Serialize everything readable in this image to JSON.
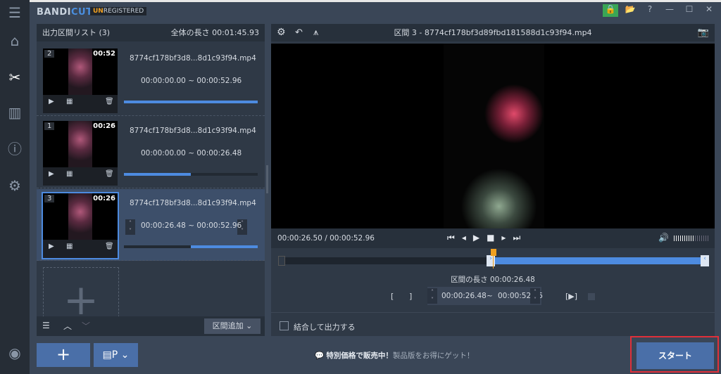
{
  "app": {
    "logo_a": "BANDI",
    "logo_b": "CUT",
    "unreg_a": "UN",
    "unreg_b": "REGISTERED"
  },
  "window": {
    "lock": "🔒",
    "folder": "📂",
    "help": "?",
    "min": "—",
    "max": "☐",
    "close": "✕"
  },
  "sidebar": [
    "menu-icon",
    "home-icon",
    "cut-icon",
    "film-icon",
    "info-icon",
    "gear-icon",
    "record-icon"
  ],
  "list": {
    "title": "出力区間リスト (3)",
    "total": "全体の長さ 00:01:45.93",
    "items": [
      {
        "num": "2",
        "dur": "00:52",
        "file": "8774cf178bf3d8...8d1c93f94.mp4",
        "range": "00:00:00.00 ~ 00:00:52.96",
        "progress": 100,
        "selected": false
      },
      {
        "num": "1",
        "dur": "00:26",
        "file": "8774cf178bf3d8...8d1c93f94.mp4",
        "range": "00:00:00.00 ~ 00:00:26.48",
        "progress": 50,
        "selected": false
      },
      {
        "num": "3",
        "dur": "00:26",
        "file": "8774cf178bf3d8...8d1c93f94.mp4",
        "range": "00:00:26.48 ~ 00:00:52.96",
        "progress": 50,
        "selected": true
      }
    ],
    "add_segment": "区間追加"
  },
  "player": {
    "title": "区間 3 - 8774cf178bf3d89fbd181588d1c93f94.mp4",
    "time": "00:00:26.50 / 00:00:52.96",
    "volume_percent": 55,
    "segment_length": "区間の長さ 00:00:26.48",
    "start": "00:00:26.48",
    "tilde": "~",
    "end": "00:00:52.96",
    "playhead_percent": 50
  },
  "merge": {
    "label": "結合して出力する",
    "checked": false
  },
  "footer": {
    "promo_bold": "特別価格で販売中！",
    "promo": "製品版をお得にゲット！",
    "start": "スタート",
    "accent": "#e0303a"
  }
}
